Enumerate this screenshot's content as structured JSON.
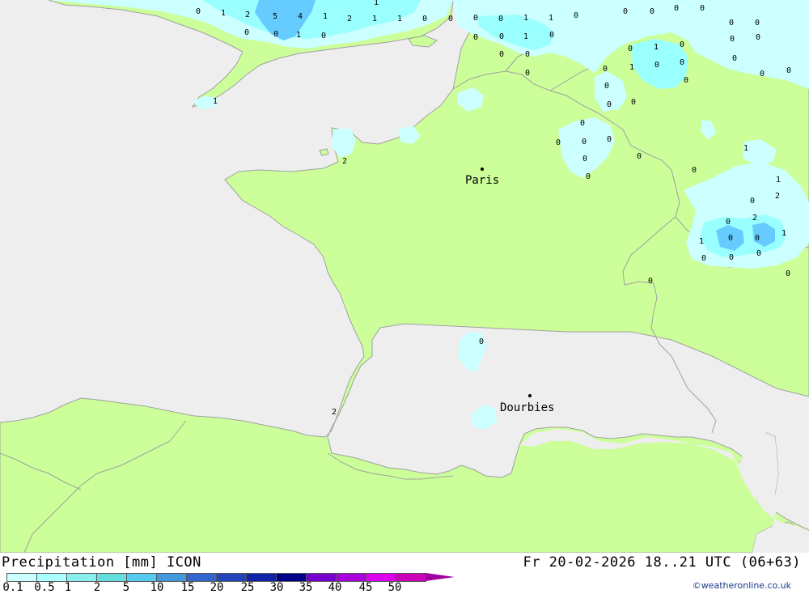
{
  "title": "Precipitation [mm] ICON",
  "valid_time": "Fr 20-02-2026 18..21 UTC (06+63)",
  "credit": "©weatheronline.co.uk",
  "colors": {
    "sea": "#eeeeee",
    "land": "#ccff99",
    "border": "#a0a0a0",
    "rain_light": "#ccffff",
    "rain_mid": "#99ffff",
    "rain_heavy": "#66ccff"
  },
  "legend": {
    "ticks": [
      "0.1",
      "0.5",
      "1",
      "2",
      "5",
      "10",
      "15",
      "20",
      "25",
      "30",
      "35",
      "40",
      "45",
      "50"
    ],
    "colors": [
      "#ccffff",
      "#aaffff",
      "#88eeee",
      "#66dddd",
      "#55ccee",
      "#4499dd",
      "#3366cc",
      "#2244bb",
      "#1122aa",
      "#000088",
      "#7700cc",
      "#aa00dd",
      "#dd00ee",
      "#cc00bb"
    ]
  },
  "cities": [
    {
      "name": "Paris"
    },
    {
      "name": "Dourbies"
    }
  ],
  "values": [
    {
      "v": "0"
    },
    {
      "v": "0"
    },
    {
      "v": "1"
    },
    {
      "v": "2"
    },
    {
      "v": "5"
    },
    {
      "v": "4"
    },
    {
      "v": "1"
    },
    {
      "v": "2"
    },
    {
      "v": "1"
    },
    {
      "v": "0"
    },
    {
      "v": "1"
    },
    {
      "v": "1"
    },
    {
      "v": "0"
    },
    {
      "v": "1"
    },
    {
      "v": "0"
    },
    {
      "v": "0"
    },
    {
      "v": "0"
    },
    {
      "v": "0"
    },
    {
      "v": "0"
    },
    {
      "v": "0"
    },
    {
      "v": "1"
    },
    {
      "v": "1"
    },
    {
      "v": "0"
    },
    {
      "v": "1"
    },
    {
      "v": "0"
    },
    {
      "v": "0"
    },
    {
      "v": "0"
    },
    {
      "v": "0"
    },
    {
      "v": "0"
    },
    {
      "v": "0"
    },
    {
      "v": "0"
    },
    {
      "v": "0"
    },
    {
      "v": "0"
    },
    {
      "v": "0"
    },
    {
      "v": "0"
    },
    {
      "v": "1"
    },
    {
      "v": "0"
    },
    {
      "v": "1"
    },
    {
      "v": "0"
    },
    {
      "v": "0"
    },
    {
      "v": "0"
    },
    {
      "v": "0"
    },
    {
      "v": "0"
    },
    {
      "v": "0"
    },
    {
      "v": "0"
    },
    {
      "v": "0"
    },
    {
      "v": "0"
    },
    {
      "v": "0"
    },
    {
      "v": "0"
    },
    {
      "v": "0"
    },
    {
      "v": "0"
    },
    {
      "v": "0"
    },
    {
      "v": "0"
    },
    {
      "v": "0"
    },
    {
      "v": "0"
    },
    {
      "v": "0"
    },
    {
      "v": "0"
    },
    {
      "v": "0"
    },
    {
      "v": "1"
    },
    {
      "v": "0"
    },
    {
      "v": "2"
    },
    {
      "v": "2"
    },
    {
      "v": "0"
    },
    {
      "v": "0"
    },
    {
      "v": "1"
    },
    {
      "v": "1"
    },
    {
      "v": "0"
    },
    {
      "v": "0"
    },
    {
      "v": "0"
    },
    {
      "v": "0"
    },
    {
      "v": "0"
    },
    {
      "v": "0"
    },
    {
      "v": "0"
    },
    {
      "v": "2"
    },
    {
      "v": "2"
    },
    {
      "v": "1"
    },
    {
      "v": "1"
    }
  ]
}
